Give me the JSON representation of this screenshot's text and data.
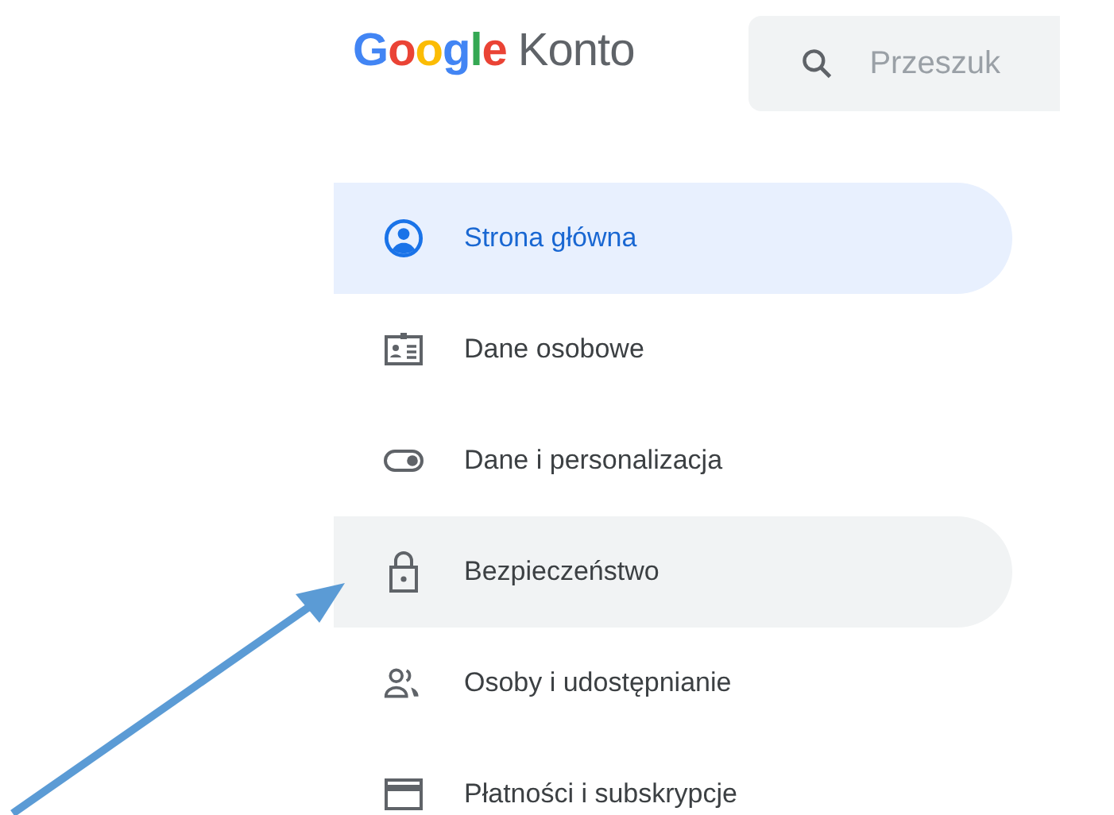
{
  "header": {
    "logo": {
      "brand": "Google",
      "product": "Konto"
    },
    "search": {
      "placeholder": "Przeszuk"
    }
  },
  "nav": {
    "items": [
      {
        "kind": "account",
        "label": "Strona główna",
        "selected": true,
        "hovered": false
      },
      {
        "kind": "id-card",
        "label": "Dane osobowe",
        "selected": false,
        "hovered": false
      },
      {
        "kind": "toggle",
        "label": "Dane i personalizacja",
        "selected": false,
        "hovered": false
      },
      {
        "kind": "lock",
        "label": "Bezpieczeństwo",
        "selected": false,
        "hovered": true
      },
      {
        "kind": "people",
        "label": "Osoby i udostępnianie",
        "selected": false,
        "hovered": false
      },
      {
        "kind": "card",
        "label": "Płatności i subskrypcje",
        "selected": false,
        "hovered": false
      }
    ]
  },
  "annotation": {
    "kind": "arrow"
  }
}
